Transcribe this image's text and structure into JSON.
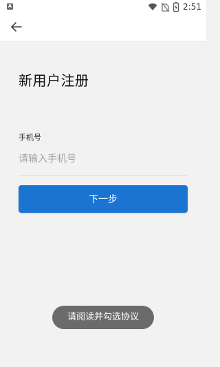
{
  "status_bar": {
    "notification_icon": "A",
    "time": "2:51",
    "icons": [
      "wifi-icon",
      "no-sim-icon",
      "battery-charging-icon"
    ]
  },
  "app_bar": {
    "back_icon": "arrow-left-icon"
  },
  "page": {
    "title": "新用户注册",
    "phone_label": "手机号",
    "phone_placeholder": "请输入手机号",
    "phone_value": "",
    "next_button": "下一步"
  },
  "toast": {
    "message": "请阅读并勾选协议"
  },
  "colors": {
    "accent": "#1b74d2",
    "background": "#f2f2f2",
    "toast_bg": "#6b6b6b"
  }
}
